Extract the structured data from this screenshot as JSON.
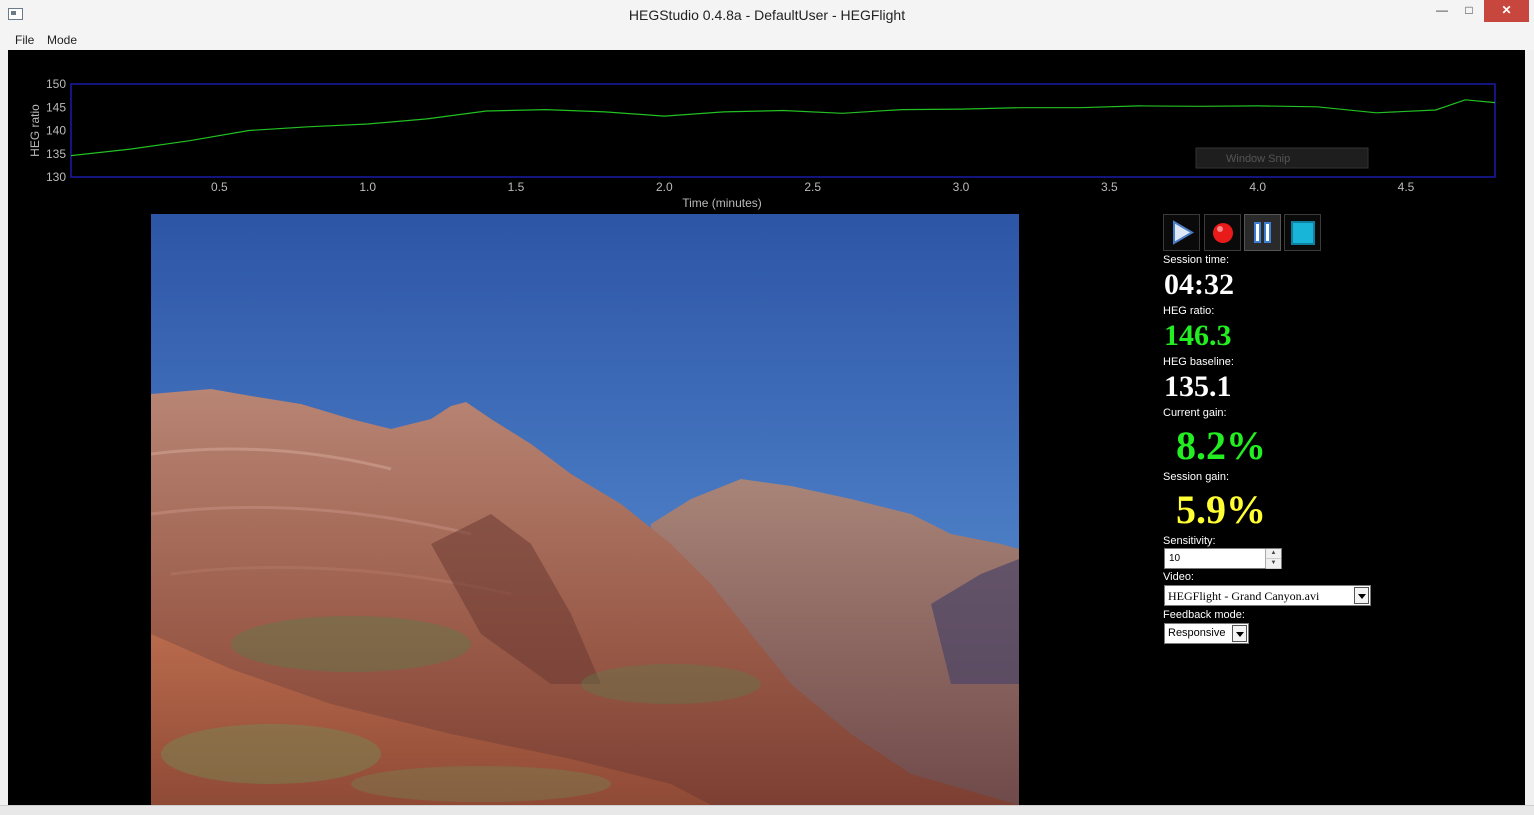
{
  "window": {
    "title": "HEGStudio 0.4.8a - DefaultUser - HEGFlight",
    "minimize": "—",
    "maximize": "□",
    "close": "✕"
  },
  "menu": [
    "File",
    "Mode"
  ],
  "chart_data": {
    "type": "line",
    "ylabel": "HEG ratio",
    "xlabel": "Time (minutes)",
    "ylim": [
      130,
      150
    ],
    "xlim": [
      0,
      4.8
    ],
    "yticks": [
      "150",
      "145",
      "140",
      "135",
      "130"
    ],
    "xticks": [
      "0.5",
      "1.0",
      "1.5",
      "2.0",
      "2.5",
      "3.0",
      "3.5",
      "4.0",
      "4.5"
    ],
    "grid": false,
    "series": [
      {
        "color": "#22c022",
        "x": [
          0,
          0.2,
          0.4,
          0.6,
          0.8,
          1.0,
          1.2,
          1.4,
          1.6,
          1.8,
          2.0,
          2.2,
          2.4,
          2.6,
          2.8,
          3.0,
          3.2,
          3.4,
          3.6,
          3.8,
          4.0,
          4.2,
          4.4,
          4.6,
          4.7,
          4.8
        ],
        "y": [
          134.6,
          136.0,
          137.8,
          140.0,
          140.8,
          141.4,
          142.5,
          144.2,
          144.5,
          144.0,
          143.1,
          144.0,
          144.3,
          143.7,
          144.5,
          144.6,
          144.9,
          144.9,
          145.3,
          145.2,
          145.3,
          145.1,
          143.8,
          144.4,
          146.6,
          146.0
        ]
      }
    ],
    "overlay_label": "Window Snip"
  },
  "controls": {
    "play_icon": "play-icon",
    "record_icon": "record-icon",
    "pause_icon": "pause-icon",
    "stop_icon": "stop-icon",
    "session_time_label": "Session time:",
    "session_time": "04:32",
    "heg_ratio_label": "HEG ratio:",
    "heg_ratio": "146.3",
    "heg_baseline_label": "HEG baseline:",
    "heg_baseline": "135.1",
    "current_gain_label": "Current gain:",
    "current_gain": "8.2%",
    "session_gain_label": "Session gain:",
    "session_gain": "5.9%",
    "sensitivity_label": "Sensitivity:",
    "sensitivity": "10",
    "video_label": "Video:",
    "video": "HEGFlight - Grand Canyon.avi",
    "feedback_mode_label": "Feedback mode:",
    "feedback_mode": "Responsive"
  },
  "colors": {
    "green_value": "#22ee22",
    "yellow_value": "#ffff33",
    "chart_border": "#1a1aa8"
  }
}
